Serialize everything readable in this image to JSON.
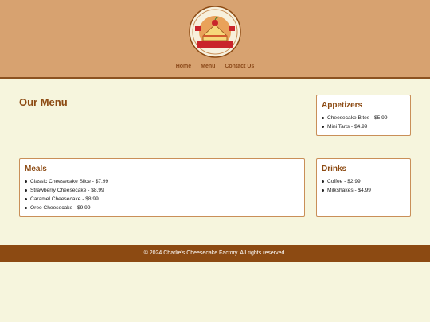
{
  "brand": {
    "logo_text": "Charlie's Cheese Cake Factory",
    "colors": {
      "header_bg": "#d7a270",
      "accent": "#8c4a12",
      "page_bg": "#f6f5dd"
    }
  },
  "nav": {
    "items": [
      {
        "label": "Home"
      },
      {
        "label": "Menu"
      },
      {
        "label": "Contact Us"
      }
    ]
  },
  "main": {
    "title": "Our Menu",
    "sections": {
      "appetizers": {
        "title": "Appetizers",
        "items": [
          "Cheesecake Bites - $5.99",
          "Mini Tarts - $4.99"
        ]
      },
      "meals": {
        "title": "Meals",
        "items": [
          "Classic Cheesecake Slice - $7.99",
          "Strawberry Cheesecake - $8.99",
          "Caramel Cheesecake - $8.99",
          "Oreo Cheesecake - $9.99"
        ]
      },
      "drinks": {
        "title": "Drinks",
        "items": [
          "Coffee - $2.99",
          "Milkshakes - $4.99"
        ]
      }
    }
  },
  "footer": {
    "text": "© 2024 Charlie's Cheesecake Factory. All rights reserved."
  }
}
